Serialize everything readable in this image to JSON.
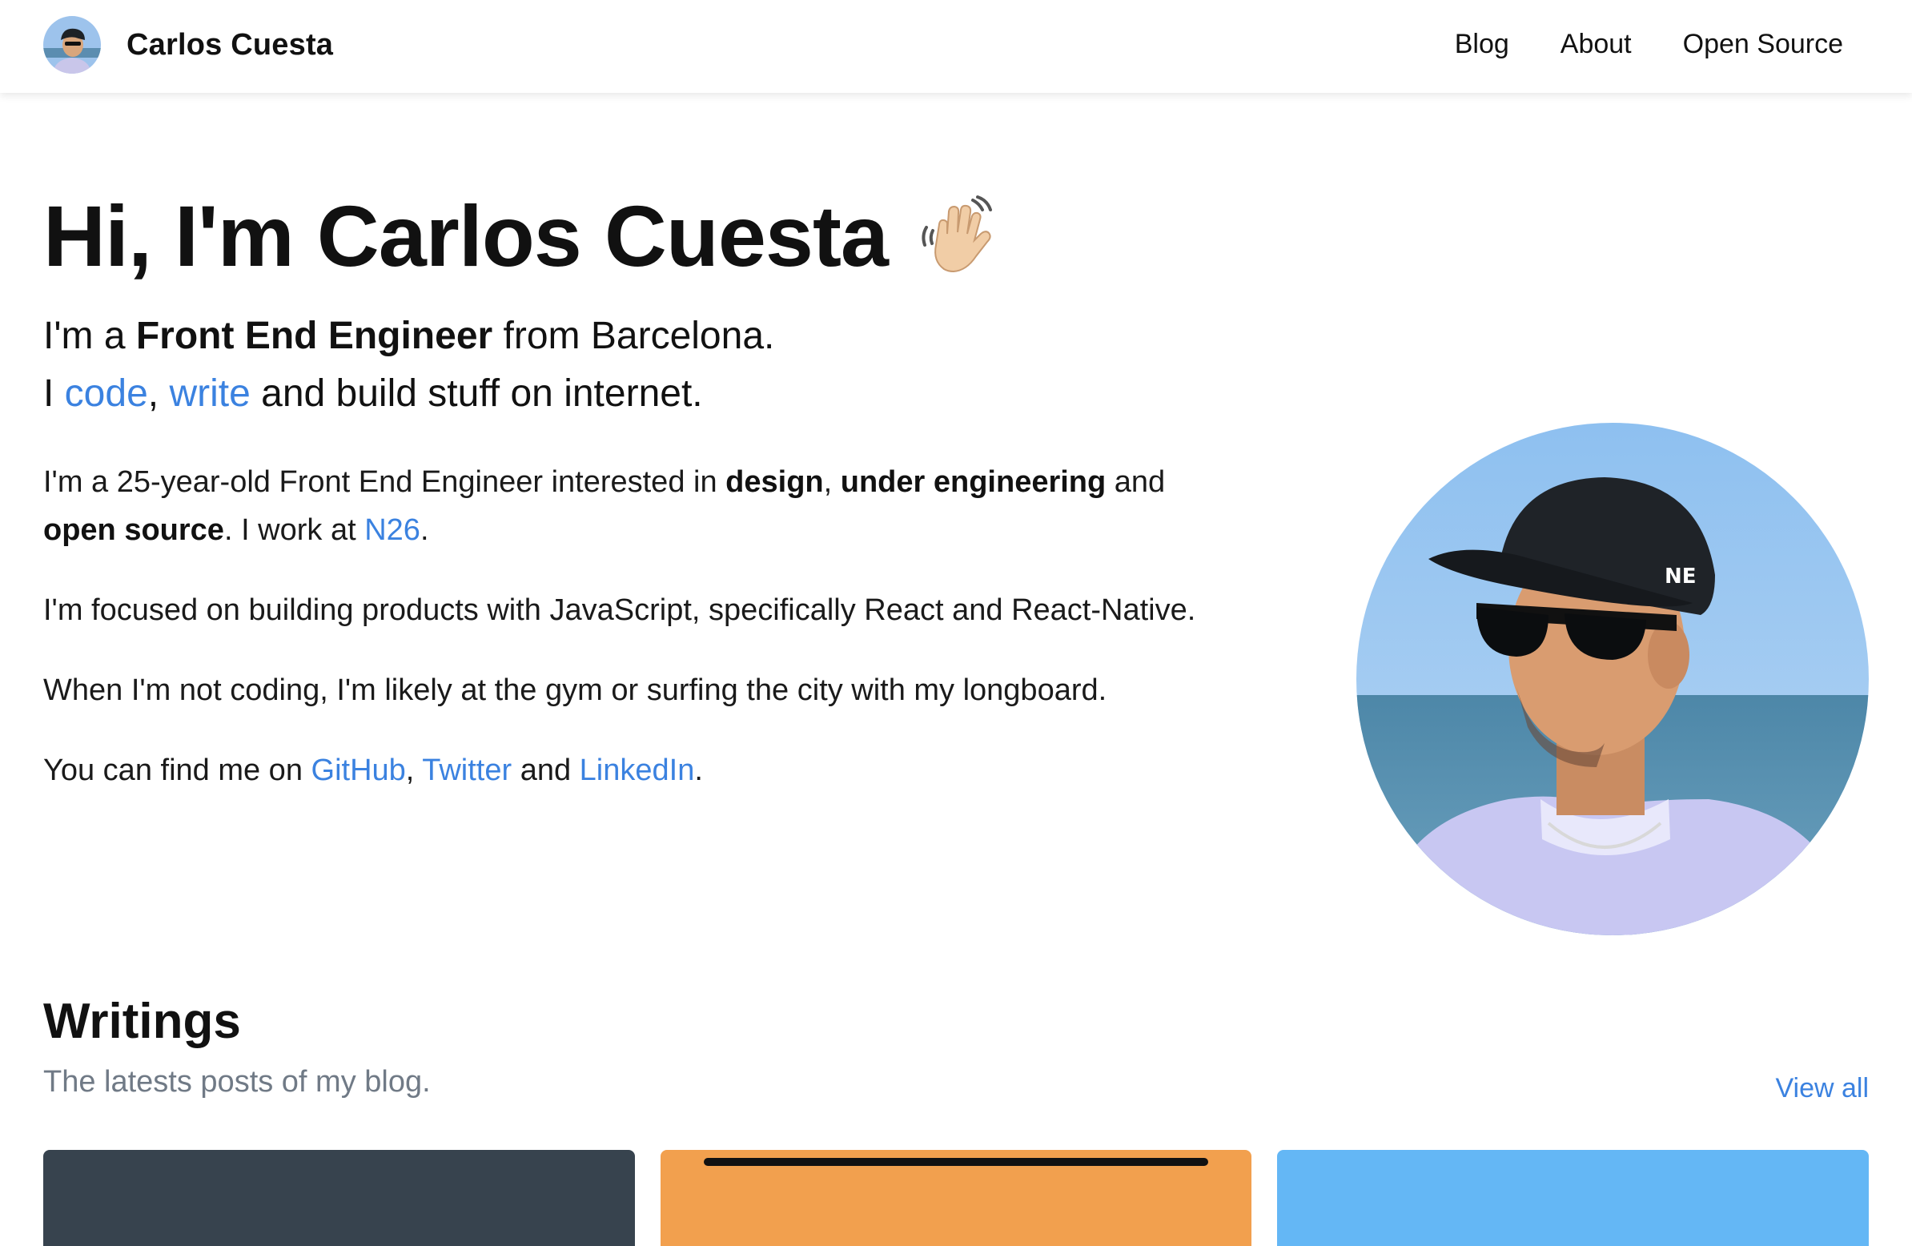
{
  "header": {
    "brand_name": "Carlos Cuesta",
    "nav": [
      "Blog",
      "About",
      "Open Source"
    ]
  },
  "hero": {
    "title": "Hi, I'm Carlos Cuesta",
    "intro_line1_prefix": "I'm a ",
    "intro_line1_bold": "Front End Engineer",
    "intro_line1_suffix": " from Barcelona.",
    "intro_line2_prefix": "I ",
    "intro_line2_link1": "code",
    "intro_line2_sep": ", ",
    "intro_line2_link2": "write",
    "intro_line2_suffix": " and build stuff on internet."
  },
  "bio": {
    "p1_a": "I'm a 25-year-old Front End Engineer interested in ",
    "p1_b1": "design",
    "p1_c": ", ",
    "p1_b2": "under engineering",
    "p1_d": " and ",
    "p1_b3": "open source",
    "p1_e": ". I work at ",
    "p1_link": "N26",
    "p1_f": ".",
    "p2": "I'm focused on building products with JavaScript, specifically React and React-Native.",
    "p3": "When I'm not coding, I'm likely at the gym or surfing the city with my longboard.",
    "p4_a": "You can find me on ",
    "p4_l1": "GitHub",
    "p4_b": ", ",
    "p4_l2": "Twitter",
    "p4_c": " and ",
    "p4_l3": "LinkedIn",
    "p4_d": "."
  },
  "writings": {
    "title": "Writings",
    "subtitle": "The latests posts of my blog.",
    "view_all": "View all",
    "card_colors": [
      "#37434e",
      "#f2a04e",
      "#64b7f5"
    ]
  },
  "colors": {
    "link": "#3b82e0",
    "muted": "#707a86"
  }
}
